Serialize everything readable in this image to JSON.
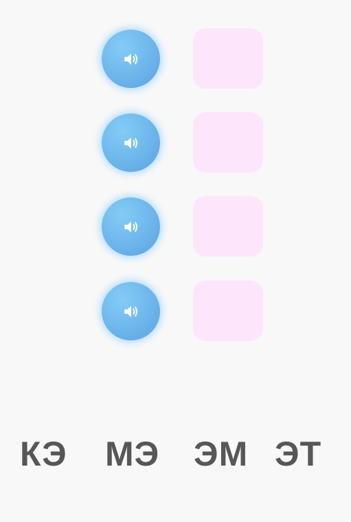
{
  "exercise": {
    "rows": [
      {
        "audio_icon": "speaker-icon",
        "slot_text": ""
      },
      {
        "audio_icon": "speaker-icon",
        "slot_text": ""
      },
      {
        "audio_icon": "speaker-icon",
        "slot_text": ""
      },
      {
        "audio_icon": "speaker-icon",
        "slot_text": ""
      }
    ],
    "choices": [
      "КЭ",
      "МЭ",
      "ЭМ",
      "ЭТ"
    ]
  },
  "colors": {
    "background": "#f8f8f8",
    "audio_button": "#6db6ec",
    "audio_glow": "#8eceff",
    "drop_slot": "#fde6fb",
    "choice_text": "#575757"
  }
}
